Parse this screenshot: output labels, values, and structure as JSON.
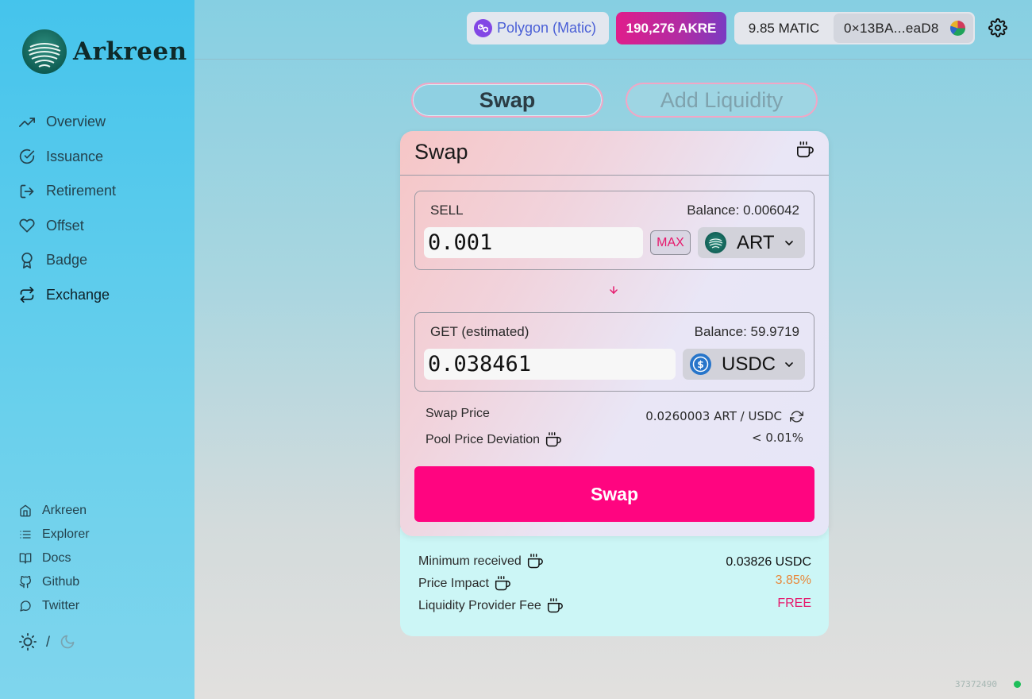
{
  "brand": {
    "name": "Arkreen"
  },
  "nav": [
    {
      "label": "Overview",
      "icon": "trending-up-icon",
      "active": false
    },
    {
      "label": "Issuance",
      "icon": "check-circle-icon",
      "active": false
    },
    {
      "label": "Retirement",
      "icon": "log-out-icon",
      "active": false
    },
    {
      "label": "Offset",
      "icon": "heart-icon",
      "active": false
    },
    {
      "label": "Badge",
      "icon": "award-icon",
      "active": false
    },
    {
      "label": "Exchange",
      "icon": "repeat-icon",
      "active": true
    }
  ],
  "links": [
    {
      "label": "Arkreen",
      "icon": "home-icon"
    },
    {
      "label": "Explorer",
      "icon": "list-icon"
    },
    {
      "label": "Docs",
      "icon": "book-icon"
    },
    {
      "label": "Github",
      "icon": "github-icon"
    },
    {
      "label": "Twitter",
      "icon": "message-circle-icon"
    }
  ],
  "theme_toggle": {
    "separator": "/"
  },
  "header": {
    "network": "Polygon (Matic)",
    "akre_balance": "190,276 AKRE",
    "matic_balance": "9.85 MATIC",
    "address": "0×13BA...eaD8"
  },
  "tabs": {
    "swap": "Swap",
    "add_liquidity": "Add Liquidity"
  },
  "card": {
    "title": "Swap",
    "sell": {
      "label": "SELL",
      "balance": "Balance: 0.006042",
      "amount": "0.001",
      "max": "MAX",
      "token": "ART"
    },
    "get": {
      "label": "GET (estimated)",
      "balance": "Balance: 59.9719",
      "amount": "0.038461",
      "token": "USDC"
    },
    "swap_price_label": "Swap Price",
    "swap_price_value": "0.0260003 ART / USDC",
    "deviation_label": "Pool Price Deviation",
    "deviation_value": "< 0.01%",
    "swap_button": "Swap"
  },
  "details": {
    "min_received_label": "Minimum received",
    "min_received_value": "0.03826 USDC",
    "price_impact_label": "Price Impact",
    "price_impact_value": "3.85%",
    "lp_fee_label": "Liquidity Provider Fee",
    "lp_fee_value": "FREE"
  },
  "block_number": "37372490",
  "colors": {
    "accent": "#ff0580",
    "price_impact": "#e8873a",
    "fee": "#e6186c",
    "status_dot": "#1fbf5a"
  }
}
